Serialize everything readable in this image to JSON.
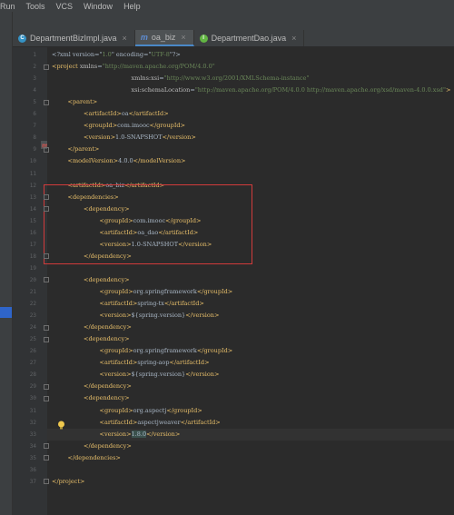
{
  "menu": [
    "Run",
    "Tools",
    "VCS",
    "Window",
    "Help"
  ],
  "tabs": [
    {
      "label": "DepartmentBizImpl.java",
      "icon": "class-icon",
      "active": false
    },
    {
      "label": "oa_biz",
      "icon": "maven-icon",
      "active": true
    },
    {
      "label": "DepartmentDao.java",
      "icon": "interface-icon",
      "active": false
    }
  ],
  "lines": [
    {
      "n": "1",
      "indent": 0,
      "parts": [
        [
          "txt",
          "<?xml version=\""
        ],
        [
          "val",
          "1.0"
        ],
        [
          "txt",
          "\" encoding=\""
        ],
        [
          "val",
          "UTF-8"
        ],
        [
          "txt",
          "\"?>"
        ]
      ]
    },
    {
      "n": "2",
      "indent": 0,
      "parts": [
        [
          "tag",
          "<project "
        ],
        [
          "attr",
          "xmlns"
        ],
        [
          "txt",
          "="
        ],
        [
          "val",
          "\"http://maven.apache.org/POM/4.0.0\""
        ]
      ]
    },
    {
      "n": "3",
      "indent": 5,
      "parts": [
        [
          "attr",
          "xmlns:xsi"
        ],
        [
          "txt",
          "="
        ],
        [
          "val",
          "\"http://www.w3.org/2001/XMLSchema-instance\""
        ]
      ]
    },
    {
      "n": "4",
      "indent": 5,
      "parts": [
        [
          "attr",
          "xsi:schemaLocation"
        ],
        [
          "txt",
          "="
        ],
        [
          "val",
          "\"http://maven.apache.org/POM/4.0.0 http://maven.apache.org/xsd/maven-4.0.0.xsd\""
        ],
        [
          "tag",
          ">"
        ]
      ]
    },
    {
      "n": "5",
      "indent": 1,
      "parts": [
        [
          "tag",
          "<parent>"
        ]
      ]
    },
    {
      "n": "6",
      "indent": 2,
      "parts": [
        [
          "tag",
          "<artifactId>"
        ],
        [
          "txt",
          "oa"
        ],
        [
          "tag",
          "</artifactId>"
        ]
      ]
    },
    {
      "n": "7",
      "indent": 2,
      "parts": [
        [
          "tag",
          "<groupId>"
        ],
        [
          "txt",
          "com.imooc"
        ],
        [
          "tag",
          "</groupId>"
        ]
      ]
    },
    {
      "n": "8",
      "indent": 2,
      "parts": [
        [
          "tag",
          "<version>"
        ],
        [
          "txt",
          "1.0-SNAPSHOT"
        ],
        [
          "tag",
          "</version>"
        ]
      ]
    },
    {
      "n": "9",
      "indent": 1,
      "parts": [
        [
          "tag",
          "</parent>"
        ]
      ]
    },
    {
      "n": "10",
      "indent": 1,
      "parts": [
        [
          "tag",
          "<modelVersion>"
        ],
        [
          "txt",
          "4.0.0"
        ],
        [
          "tag",
          "</modelVersion>"
        ]
      ]
    },
    {
      "n": "11",
      "indent": 0,
      "parts": []
    },
    {
      "n": "12",
      "indent": 1,
      "parts": [
        [
          "tag",
          "<artifactId>"
        ],
        [
          "txt",
          "oa_biz"
        ],
        [
          "tag",
          "</artifactId>"
        ]
      ]
    },
    {
      "n": "13",
      "indent": 1,
      "parts": [
        [
          "tag",
          "<dependencies>"
        ]
      ]
    },
    {
      "n": "14",
      "indent": 2,
      "parts": [
        [
          "tag",
          "<dependency>"
        ]
      ]
    },
    {
      "n": "15",
      "indent": 3,
      "parts": [
        [
          "tag",
          "<groupId>"
        ],
        [
          "txt",
          "com.imooc"
        ],
        [
          "tag",
          "</groupId>"
        ]
      ]
    },
    {
      "n": "16",
      "indent": 3,
      "parts": [
        [
          "tag",
          "<artifactId>"
        ],
        [
          "txt",
          "oa_dao"
        ],
        [
          "tag",
          "</artifactId>"
        ]
      ]
    },
    {
      "n": "17",
      "indent": 3,
      "parts": [
        [
          "tag",
          "<version>"
        ],
        [
          "txt",
          "1.0-SNAPSHOT"
        ],
        [
          "tag",
          "</version>"
        ]
      ]
    },
    {
      "n": "18",
      "indent": 2,
      "parts": [
        [
          "tag",
          "</dependency>"
        ]
      ]
    },
    {
      "n": "19",
      "indent": 0,
      "parts": []
    },
    {
      "n": "20",
      "indent": 2,
      "parts": [
        [
          "tag",
          "<dependency>"
        ]
      ]
    },
    {
      "n": "21",
      "indent": 3,
      "parts": [
        [
          "tag",
          "<groupId>"
        ],
        [
          "txt",
          "org.springframework"
        ],
        [
          "tag",
          "</groupId>"
        ]
      ]
    },
    {
      "n": "22",
      "indent": 3,
      "parts": [
        [
          "tag",
          "<artifactId>"
        ],
        [
          "txt",
          "spring-tx"
        ],
        [
          "tag",
          "</artifactId>"
        ]
      ]
    },
    {
      "n": "23",
      "indent": 3,
      "parts": [
        [
          "tag",
          "<version>"
        ],
        [
          "txt",
          "${spring.version}"
        ],
        [
          "tag",
          "</version>"
        ]
      ]
    },
    {
      "n": "24",
      "indent": 2,
      "parts": [
        [
          "tag",
          "</dependency>"
        ]
      ]
    },
    {
      "n": "25",
      "indent": 2,
      "parts": [
        [
          "tag",
          "<dependency>"
        ]
      ]
    },
    {
      "n": "26",
      "indent": 3,
      "parts": [
        [
          "tag",
          "<groupId>"
        ],
        [
          "txt",
          "org.springframework"
        ],
        [
          "tag",
          "</groupId>"
        ]
      ]
    },
    {
      "n": "27",
      "indent": 3,
      "parts": [
        [
          "tag",
          "<artifactId>"
        ],
        [
          "txt",
          "spring-aop"
        ],
        [
          "tag",
          "</artifactId>"
        ]
      ]
    },
    {
      "n": "28",
      "indent": 3,
      "parts": [
        [
          "tag",
          "<version>"
        ],
        [
          "txt",
          "${spring.version}"
        ],
        [
          "tag",
          "</version>"
        ]
      ]
    },
    {
      "n": "29",
      "indent": 2,
      "parts": [
        [
          "tag",
          "</dependency>"
        ]
      ]
    },
    {
      "n": "30",
      "indent": 2,
      "parts": [
        [
          "tag",
          "<dependency>"
        ]
      ]
    },
    {
      "n": "31",
      "indent": 3,
      "parts": [
        [
          "tag",
          "<groupId>"
        ],
        [
          "txt",
          "org.aspectj"
        ],
        [
          "tag",
          "</groupId>"
        ]
      ]
    },
    {
      "n": "32",
      "indent": 3,
      "parts": [
        [
          "tag",
          "<artifactId>"
        ],
        [
          "txt",
          "aspectjweaver"
        ],
        [
          "tag",
          "</artifactId>"
        ]
      ]
    },
    {
      "n": "33",
      "indent": 3,
      "parts": [
        [
          "tag",
          "<version>"
        ],
        [
          "txt",
          "1.8.0"
        ],
        [
          "tag",
          "</version>"
        ]
      ]
    },
    {
      "n": "34",
      "indent": 2,
      "parts": [
        [
          "tag",
          "</dependency>"
        ]
      ]
    },
    {
      "n": "35",
      "indent": 1,
      "parts": [
        [
          "tag",
          "</dependencies>"
        ]
      ]
    },
    {
      "n": "36",
      "indent": 0,
      "parts": []
    },
    {
      "n": "37",
      "indent": 0,
      "parts": [
        [
          "tag",
          "</project>"
        ]
      ]
    }
  ],
  "colors": {
    "tag": "#e8bf6a",
    "attr": "#bababa",
    "value": "#6a8759",
    "text": "#a9b7c6",
    "highlight_box": "#d13b3b"
  }
}
